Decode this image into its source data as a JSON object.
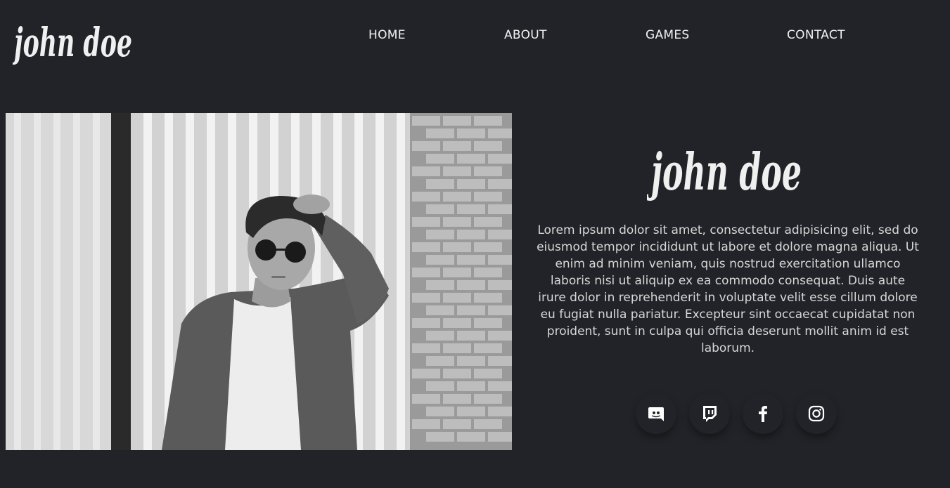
{
  "header": {
    "logo_text": "john doe",
    "nav": [
      {
        "label": "HOME"
      },
      {
        "label": "ABOUT"
      },
      {
        "label": "GAMES"
      },
      {
        "label": "CONTACT"
      }
    ]
  },
  "about": {
    "name": "john doe",
    "bio": "Lorem ipsum dolor sit amet, consectetur adipisicing elit, sed do eiusmod tempor incididunt ut labore et dolore magna aliqua. Ut enim ad minim veniam, quis nostrud exercitation ullamco laboris nisi ut aliquip ex ea commodo consequat. Duis aute irure dolor in reprehenderit in voluptate velit esse cillum dolore eu fugiat nulla pariatur. Excepteur sint occaecat cupidatat non proident, sunt in culpa qui officia deserunt mollit anim id est laborum.",
    "photo_icon": "portrait-photo"
  },
  "social": [
    {
      "icon": "discord-icon"
    },
    {
      "icon": "twitch-icon"
    },
    {
      "icon": "facebook-icon"
    },
    {
      "icon": "instagram-icon"
    }
  ],
  "colors": {
    "background": "#222328",
    "text": "#e6e6e6",
    "icon": "#ffffff"
  }
}
